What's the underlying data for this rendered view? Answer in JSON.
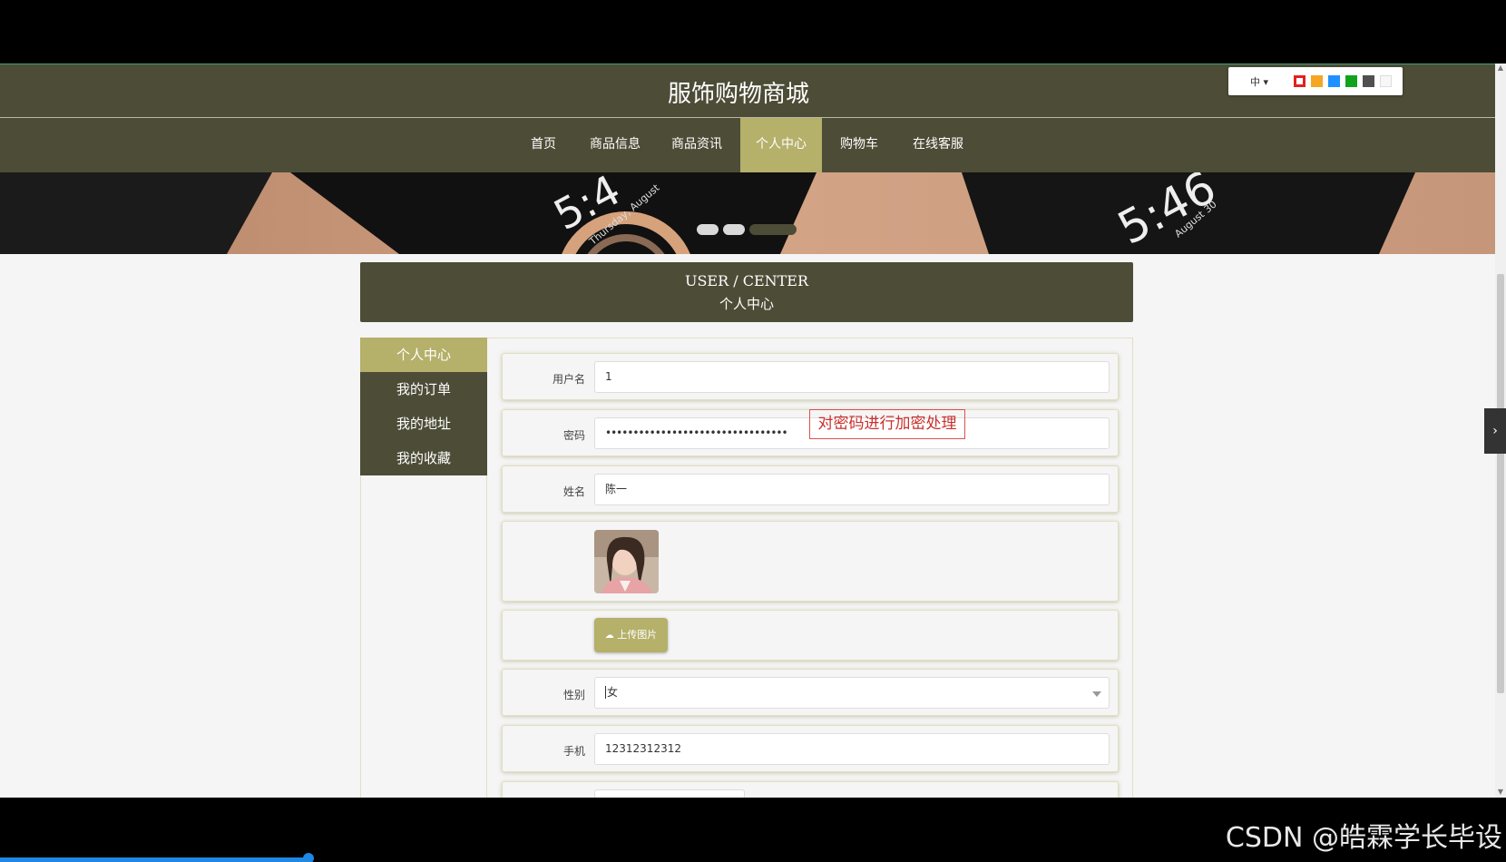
{
  "site": {
    "title": "服饰购物商城"
  },
  "theme_switcher": {
    "language": "中 ▾",
    "colors": [
      "#e32020",
      "#f5a623",
      "#1e90ff",
      "#13a21d",
      "#505050",
      "#f7f7f7"
    ]
  },
  "nav": {
    "items": [
      {
        "label": "首页"
      },
      {
        "label": "商品信息"
      },
      {
        "label": "商品资讯"
      },
      {
        "label": "个人中心"
      },
      {
        "label": "购物车"
      },
      {
        "label": "在线客服"
      }
    ],
    "active": "个人中心"
  },
  "banner": {
    "text_left": "5:4",
    "text_left_small": "Thursday, August",
    "text_right": "5:46",
    "text_right_small": "August 30"
  },
  "user_center": {
    "en": "USER / CENTER",
    "cn": "个人中心"
  },
  "sidebar": {
    "items": [
      {
        "label": "个人中心"
      },
      {
        "label": "我的订单"
      },
      {
        "label": "我的地址"
      },
      {
        "label": "我的收藏"
      }
    ]
  },
  "form": {
    "username_label": "用户名",
    "username_value": "1",
    "password_label": "密码",
    "password_value": "•••••••••••••••••••••••••••••••••",
    "name_label": "姓名",
    "name_value": "陈一",
    "upload_label": "上传图片",
    "gender_label": "性别",
    "gender_value": "女",
    "phone_label": "手机",
    "phone_value": "12312312312"
  },
  "annotation": {
    "text": "对密码进行加密处理"
  },
  "watermark": {
    "text": "CSDN @皓霖学长毕设"
  },
  "video_progress": 0.205
}
